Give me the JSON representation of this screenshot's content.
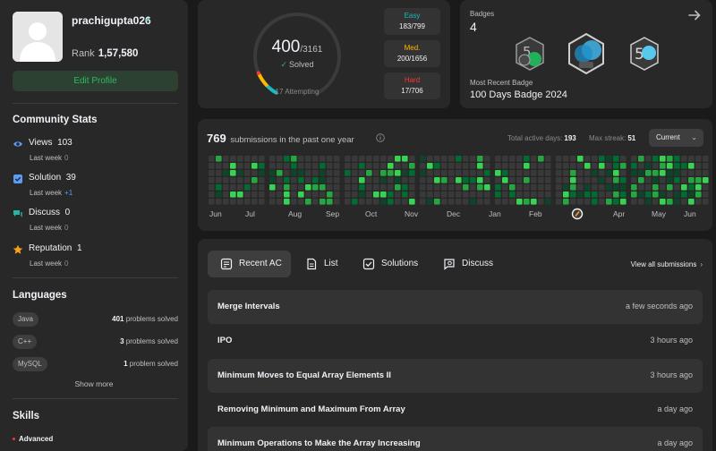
{
  "profile": {
    "username": "prachigupta026",
    "rank_label": "Rank",
    "rank_value": "1,57,580",
    "edit_label": "Edit Profile"
  },
  "community": {
    "title": "Community Stats",
    "items": [
      {
        "label": "Views",
        "value": "103",
        "sub_label": "Last week",
        "sub_value": "0",
        "icon": "eye-icon",
        "color": "#5a9cf8"
      },
      {
        "label": "Solution",
        "value": "39",
        "sub_label": "Last week",
        "sub_value": "+1",
        "icon": "solution-check-icon",
        "color": "#5a9cf8"
      },
      {
        "label": "Discuss",
        "value": "0",
        "sub_label": "Last week",
        "sub_value": "0",
        "icon": "discuss-icon",
        "color": "#2bb3a2"
      },
      {
        "label": "Reputation",
        "value": "1",
        "sub_label": "Last week",
        "sub_value": "0",
        "icon": "star-icon",
        "color": "#ffa116"
      }
    ]
  },
  "languages": {
    "title": "Languages",
    "items": [
      {
        "name": "Java",
        "count": "401",
        "suffix": "problems solved"
      },
      {
        "name": "C++",
        "count": "3",
        "suffix": "problems solved"
      },
      {
        "name": "MySQL",
        "count": "1",
        "suffix": "problem solved"
      }
    ],
    "show_more": "Show more"
  },
  "skills": {
    "title": "Skills",
    "first_level": "Advanced"
  },
  "progress": {
    "solved": "400",
    "total": "/3161",
    "solved_label": "Solved",
    "solved_fraction": 0.1265,
    "attempting": "17 Attempting",
    "difficulties": [
      {
        "name": "Easy",
        "value": "183/799",
        "color": "#1cbaba"
      },
      {
        "name": "Med.",
        "value": "200/1656",
        "color": "#ffb700"
      },
      {
        "name": "Hard",
        "value": "17/706",
        "color": "#f63737"
      }
    ]
  },
  "badges": {
    "label": "Badges",
    "count": "4",
    "recent_label": "Most Recent Badge",
    "recent_name": "100 Days Badge 2024"
  },
  "heatmap": {
    "count": "769",
    "count_suffix": "submissions in the past one year",
    "active_days_label": "Total active days:",
    "active_days": "193",
    "max_streak_label": "Max streak:",
    "max_streak": "51",
    "dropdown": "Current",
    "months": [
      "Jun",
      "Jul",
      "Aug",
      "Sep",
      "Oct",
      "Nov",
      "Dec",
      "Jan",
      "Feb",
      "Apr",
      "May",
      "Jun"
    ]
  },
  "submissions": {
    "tabs": [
      {
        "label": "Recent AC",
        "icon": "recent-ac-icon"
      },
      {
        "label": "List",
        "icon": "list-icon"
      },
      {
        "label": "Solutions",
        "icon": "solutions-icon"
      },
      {
        "label": "Discuss",
        "icon": "discuss-search-icon"
      }
    ],
    "view_all": "View all submissions",
    "rows": [
      {
        "title": "Merge Intervals",
        "time": "a few seconds ago"
      },
      {
        "title": "IPO",
        "time": "3 hours ago"
      },
      {
        "title": "Minimum Moves to Equal Array Elements II",
        "time": "3 hours ago"
      },
      {
        "title": "Removing Minimum and Maximum From Array",
        "time": "a day ago"
      },
      {
        "title": "Minimum Operations to Make the Array Increasing",
        "time": "a day ago"
      }
    ]
  }
}
